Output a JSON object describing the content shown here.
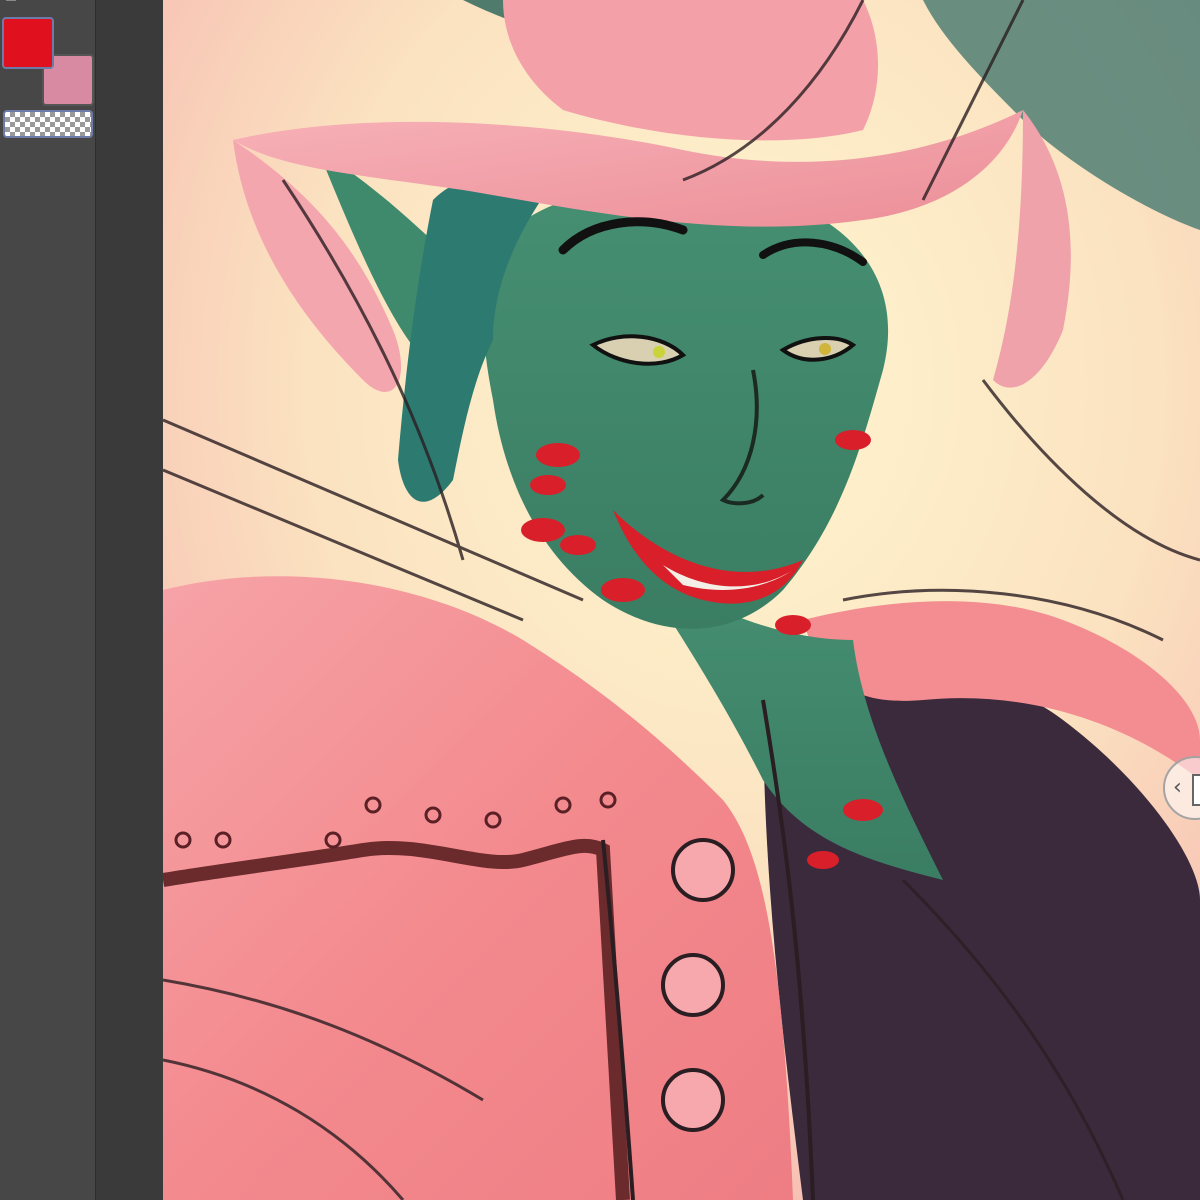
{
  "colors": {
    "main_color": "#e0101e",
    "sub_color": "#d98aa3",
    "panel_bg": "#474747",
    "swatch_border": "#6d7ba8"
  },
  "tool_panel": {
    "main_color_swatch": {
      "color": "#e0101e",
      "icon": "main-color-swatch"
    },
    "sub_color_swatch": {
      "color": "#d98aa3",
      "icon": "sub-color-swatch"
    },
    "transparent_swatch": {
      "icon": "transparent-color-checker"
    }
  },
  "canvas": {
    "subject": "illustration",
    "palette": {
      "background_warm": "#fbe6c8",
      "coat_pink": "#f58e92",
      "hat_pink": "#f3a0a8",
      "skin_green": "#3f8a6c",
      "hair_teal": "#2d7a70",
      "lipstick_red": "#d81f2a",
      "shirt_dark": "#3b2a3c",
      "sketch_line": "#2a1e22"
    }
  },
  "collapse_handle": {
    "glyph": "‹",
    "icon": "collapse-panel-icon"
  }
}
